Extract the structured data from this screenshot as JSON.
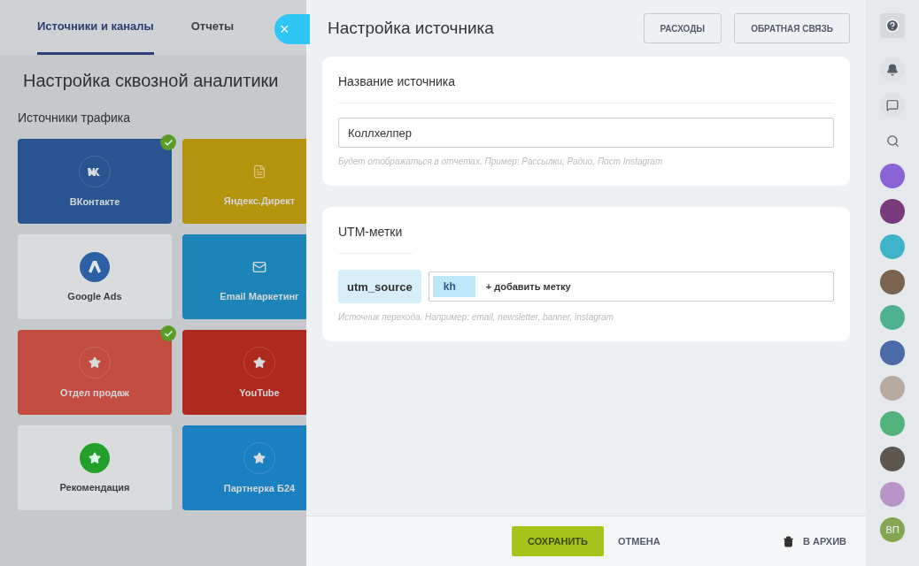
{
  "background": {
    "tabs": [
      {
        "label": "Источники и каналы",
        "selected": true
      },
      {
        "label": "Отчеты",
        "selected": false
      }
    ],
    "title": "Настройка сквозной аналитики",
    "section": "Источники трафика",
    "sources": [
      {
        "name": "ВКонтакте",
        "kind": "vk",
        "color": "#28558f",
        "checked": true
      },
      {
        "name": "Яндекс.Директ",
        "kind": "doc",
        "color": "#b4930f",
        "checked": false
      },
      {
        "name": "Google Ads",
        "kind": "ads",
        "color": "#d9dbdc",
        "checked": false
      },
      {
        "name": "Email Маркетинг",
        "kind": "mail",
        "color": "#1c84b8",
        "checked": false
      },
      {
        "name": "Отдел продаж",
        "kind": "star",
        "color": "#c24d40",
        "checked": true
      },
      {
        "name": "YouTube",
        "kind": "star",
        "color": "#ae2a1f",
        "checked": false
      },
      {
        "name": "Рекомендация",
        "kind": "star-filled",
        "color": "#d9dbdc",
        "checked": false
      },
      {
        "name": "Партнерка Б24",
        "kind": "star",
        "color": "#1b80c2",
        "checked": false
      }
    ]
  },
  "close_button": "×",
  "slider": {
    "title": "Настройка источника",
    "header_buttons": [
      "РАСХОДЫ",
      "ОБРАТНАЯ СВЯЗЬ"
    ],
    "name_card": {
      "title": "Название источника",
      "value": "Коллхелпер",
      "hint": "Будет отображаться в отчетах. Пример: Рассылки, Радио, Пост Instagram"
    },
    "utm_card": {
      "title": "UTM-метки",
      "param": "utm_source",
      "tags": [
        "kh"
      ],
      "add_label": "+ добавить метку",
      "hint": "Источник перехода. Например: email, newsletter, banner, instagram"
    },
    "footer": {
      "save": "СОХРАНИТЬ",
      "cancel": "ОТМЕНА",
      "archive": "В АРХИВ"
    }
  },
  "sidebar": [
    {
      "kind": "help"
    },
    {
      "kind": "bell"
    },
    {
      "kind": "chat"
    },
    {
      "kind": "search"
    },
    {
      "kind": "avatar",
      "color": "#8a63d6"
    },
    {
      "kind": "avatar",
      "color": "#7a3a7e"
    },
    {
      "kind": "avatar",
      "color": "#3fb3c8"
    },
    {
      "kind": "photo",
      "color": "#7a6450"
    },
    {
      "kind": "avatar",
      "color": "#4fb08f"
    },
    {
      "kind": "avatar",
      "color": "#4a6aa8"
    },
    {
      "kind": "photo",
      "color": "#b9aaa0"
    },
    {
      "kind": "avatar",
      "color": "#52b27a"
    },
    {
      "kind": "photo",
      "color": "#5e5650"
    },
    {
      "kind": "avatar",
      "color": "#b994c8"
    },
    {
      "kind": "initials",
      "label": "ВП",
      "color": "#86a653"
    }
  ]
}
